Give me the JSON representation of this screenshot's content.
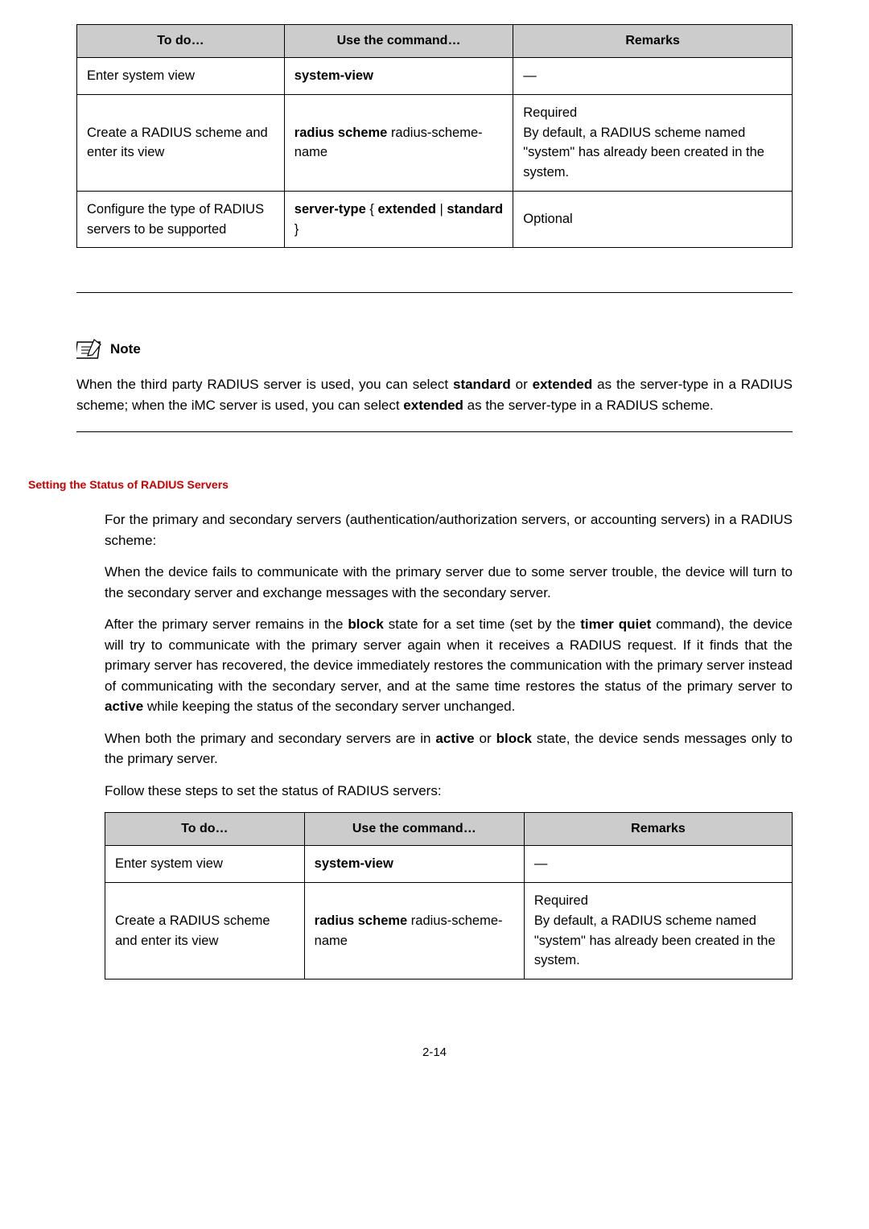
{
  "table1": {
    "headers": [
      "To do…",
      "Use the command…",
      "Remarks"
    ],
    "rows": [
      {
        "c1": "Enter system view",
        "c2_bold": "system-view",
        "c3": "—"
      },
      {
        "c1": "Create a RADIUS scheme and enter its view",
        "c2_bold": "radius scheme ",
        "c2_plain": "radius-scheme-name",
        "c3_line1": "Required",
        "c3_rest": "By default, a RADIUS scheme named \"system\" has already been created in the system."
      },
      {
        "c1": "Configure the type of RADIUS servers to be supported",
        "c2_a": "server-type",
        "c2_b": " { ",
        "c2_c": "extended",
        "c2_d": " | ",
        "c2_e": "standard",
        "c2_f": " }",
        "c3": "Optional"
      }
    ]
  },
  "note": {
    "label": "Note",
    "p1a": "When the third party RADIUS server is used, you can select ",
    "p1b": "standard",
    "p1c": " or ",
    "p1d": "extended",
    "p1e": " as the server-type in a RADIUS scheme; when the iMC  server is used, you can select ",
    "p1f": "extended",
    "p1g": " as the server-type in a RADIUS scheme."
  },
  "section_heading": "Setting the Status of RADIUS Servers",
  "body": {
    "p1": "For the primary and secondary servers (authentication/authorization servers, or accounting servers) in a RADIUS scheme:",
    "p2": "When the device fails to communicate with the primary server due to some server trouble, the device will turn to the secondary server and exchange messages with the secondary server.",
    "p3a": "After the primary server remains in the ",
    "p3b": "block",
    "p3c": " state for a set time (set by the ",
    "p3d": "timer quiet",
    "p3e": " command), the device will try to communicate with the primary server again when it receives a RADIUS request. If it finds that the primary server has recovered, the device immediately restores the communication with the primary server instead of communicating with the secondary server, and at the same time restores the status of the primary server to ",
    "p3f": "active",
    "p3g": " while keeping the status of the secondary server unchanged.",
    "p4a": "When both the primary and secondary servers are in ",
    "p4b": "active",
    "p4c": " or ",
    "p4d": "block",
    "p4e": " state, the device sends messages only to the primary server.",
    "p5": "Follow these steps to set the status of RADIUS servers:"
  },
  "table2": {
    "headers": [
      "To do…",
      "Use the command…",
      "Remarks"
    ],
    "rows": [
      {
        "c1": "Enter system view",
        "c2_bold": "system-view",
        "c3": "—"
      },
      {
        "c1": "Create a RADIUS scheme and enter its view",
        "c2_bold": "radius scheme ",
        "c2_plain": "radius-scheme-name",
        "c3_line1": "Required",
        "c3_rest": "By default, a RADIUS scheme named \"system\" has already been created in the system."
      }
    ]
  },
  "page_number": "2-14"
}
